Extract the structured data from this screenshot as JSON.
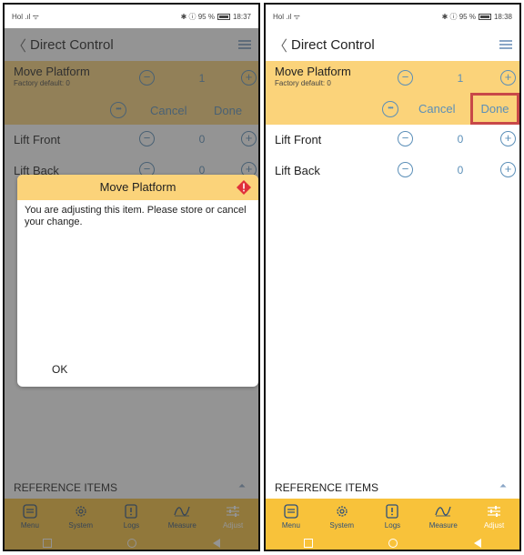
{
  "status": {
    "carrier": "Hol .ıl ᯤ",
    "left_right": "✱ ⓘ 95 %",
    "left_time": "18:37",
    "right_right": "✱ ⓘ 95 %",
    "right_time": "18:38"
  },
  "header": {
    "back": "〈",
    "title": "Direct Control"
  },
  "active_item": {
    "label": "Move Platform",
    "sub": "Factory default: 0",
    "value": "1",
    "minus": "−",
    "plus": "+",
    "dots": "•••",
    "cancel": "Cancel",
    "done": "Done"
  },
  "items": [
    {
      "label": "Lift Front",
      "value": "0"
    },
    {
      "label": "Lift Back",
      "value": "0"
    }
  ],
  "reference": {
    "label": "REFERENCE ITEMS"
  },
  "tabs": [
    {
      "label": "Menu",
      "icon": "menu-icon"
    },
    {
      "label": "System",
      "icon": "gear-icon"
    },
    {
      "label": "Logs",
      "icon": "logs-icon"
    },
    {
      "label": "Measure",
      "icon": "wave-icon"
    },
    {
      "label": "Adjust",
      "icon": "sliders-icon"
    }
  ],
  "dialog": {
    "title": "Move Platform",
    "message": "You are adjusting this item. Please store or cancel your change.",
    "ok": "OK"
  },
  "colors": {
    "accent": "#f8c23a",
    "highlight_row": "#fbd37a",
    "icon_blue": "#5b8fb8",
    "done_border": "#c84848",
    "warning": "#e0303a"
  }
}
